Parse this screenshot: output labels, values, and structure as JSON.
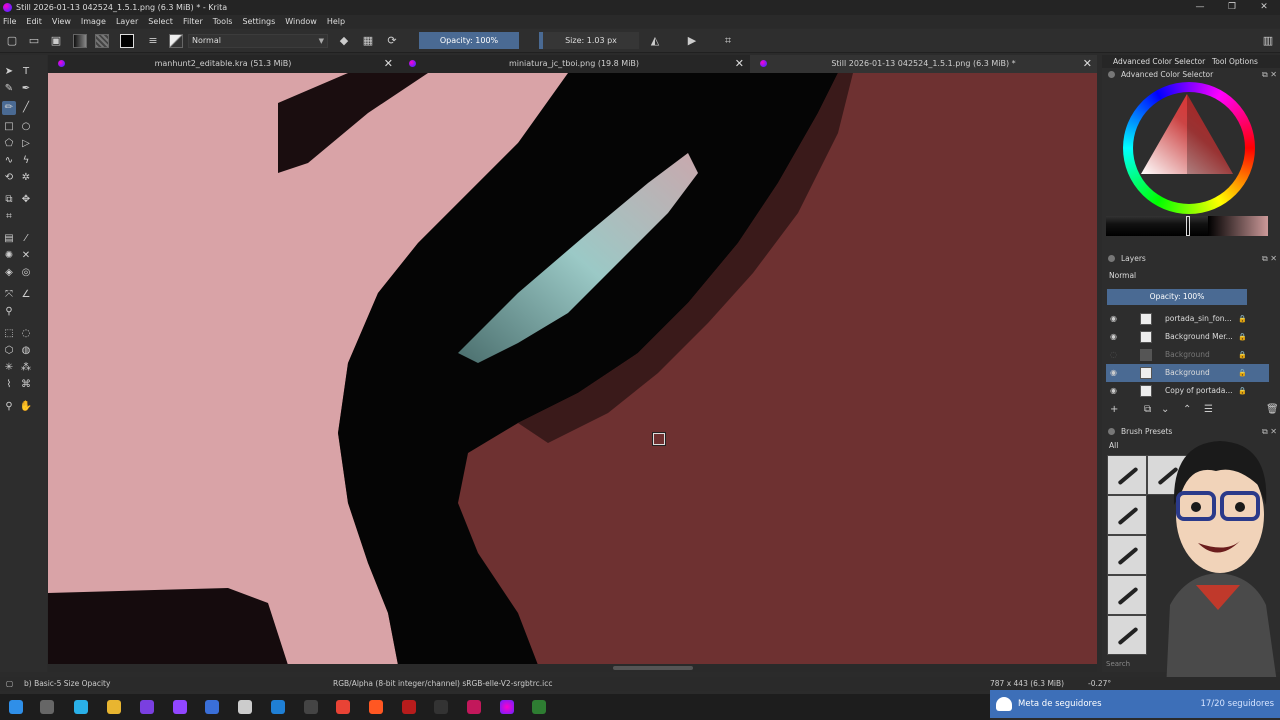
{
  "window": {
    "title": "Still 2026-01-13 042524_1.5.1.png (6.3 MiB) * - Krita",
    "controls": [
      "—",
      "❐",
      "✕"
    ]
  },
  "menu": [
    "File",
    "Edit",
    "View",
    "Image",
    "Layer",
    "Select",
    "Filter",
    "Tools",
    "Settings",
    "Window",
    "Help"
  ],
  "toolbar": {
    "blend_mode": "Normal",
    "opacity": "Opacity: 100%",
    "size": "Size: 1.03 px"
  },
  "tabs": [
    {
      "label": "manhunt2_editable.kra (51.3 MiB)",
      "active": false
    },
    {
      "label": "miniatura_jc_tboi.png (19.8 MiB)",
      "active": false
    },
    {
      "label": "Still 2026-01-13 042524_1.5.1.png (6.3 MiB) *",
      "active": true
    }
  ],
  "dock": {
    "tabs": [
      "Advanced Color Selector",
      "Tool Options"
    ],
    "color_selector_title": "Advanced Color Selector",
    "layers_title": "Layers",
    "layers_blend": "Normal",
    "layers_opacity": "Opacity: 100%",
    "layers": [
      {
        "name": "portada_sin_fon...",
        "visible": true,
        "active": false
      },
      {
        "name": "Background Mer...",
        "visible": true,
        "active": false
      },
      {
        "name": "Background",
        "visible": false,
        "active": false
      },
      {
        "name": "Background",
        "visible": true,
        "active": true
      },
      {
        "name": "Copy of portada...",
        "visible": true,
        "active": false
      }
    ],
    "brush_presets_title": "Brush Presets",
    "brush_filter": "All",
    "brush_search": "Search"
  },
  "status": {
    "brush": "b) Basic-5 Size Opacity",
    "color_profile": "RGB/Alpha (8-bit integer/channel)  sRGB-elle-V2-srgbtrc.icc",
    "dimensions": "787 x 443 (6.3 MiB)",
    "rotation": "-0.27°"
  },
  "overlay": {
    "label": "Meta de seguidores",
    "count": "17/20 seguidores"
  },
  "colors": {
    "accent": "#4a6a93",
    "canvas_red": "#6e3131",
    "canvas_pink": "#d9a3a7"
  }
}
